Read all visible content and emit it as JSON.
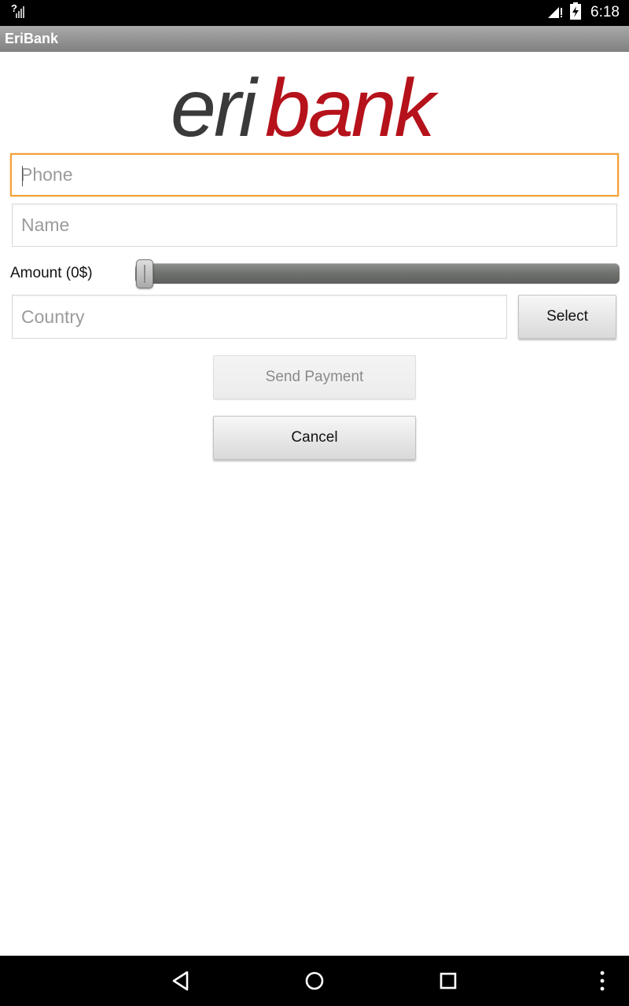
{
  "status_bar": {
    "time": "6:18",
    "icons": [
      "unknown-signal-icon",
      "cellular-signal-icon",
      "battery-charging-icon"
    ]
  },
  "app": {
    "title": "EriBank"
  },
  "logo": {
    "part1": "eri",
    "part2": "bank",
    "part1_color": "#3a3a3a",
    "part2_color": "#b5121b"
  },
  "form": {
    "phone_placeholder": "Phone",
    "phone_value": "",
    "name_placeholder": "Name",
    "name_value": "",
    "amount_label": "Amount (0$)",
    "amount_value": 0,
    "country_placeholder": "Country",
    "country_value": "",
    "select_label": "Select",
    "send_label": "Send Payment",
    "cancel_label": "Cancel"
  },
  "nav_bar": {
    "icons": [
      "back-icon",
      "home-icon",
      "recents-icon",
      "overflow-menu-icon"
    ]
  },
  "colors": {
    "focus_border": "#f4a036",
    "app_bar": "#8f8f8f"
  }
}
